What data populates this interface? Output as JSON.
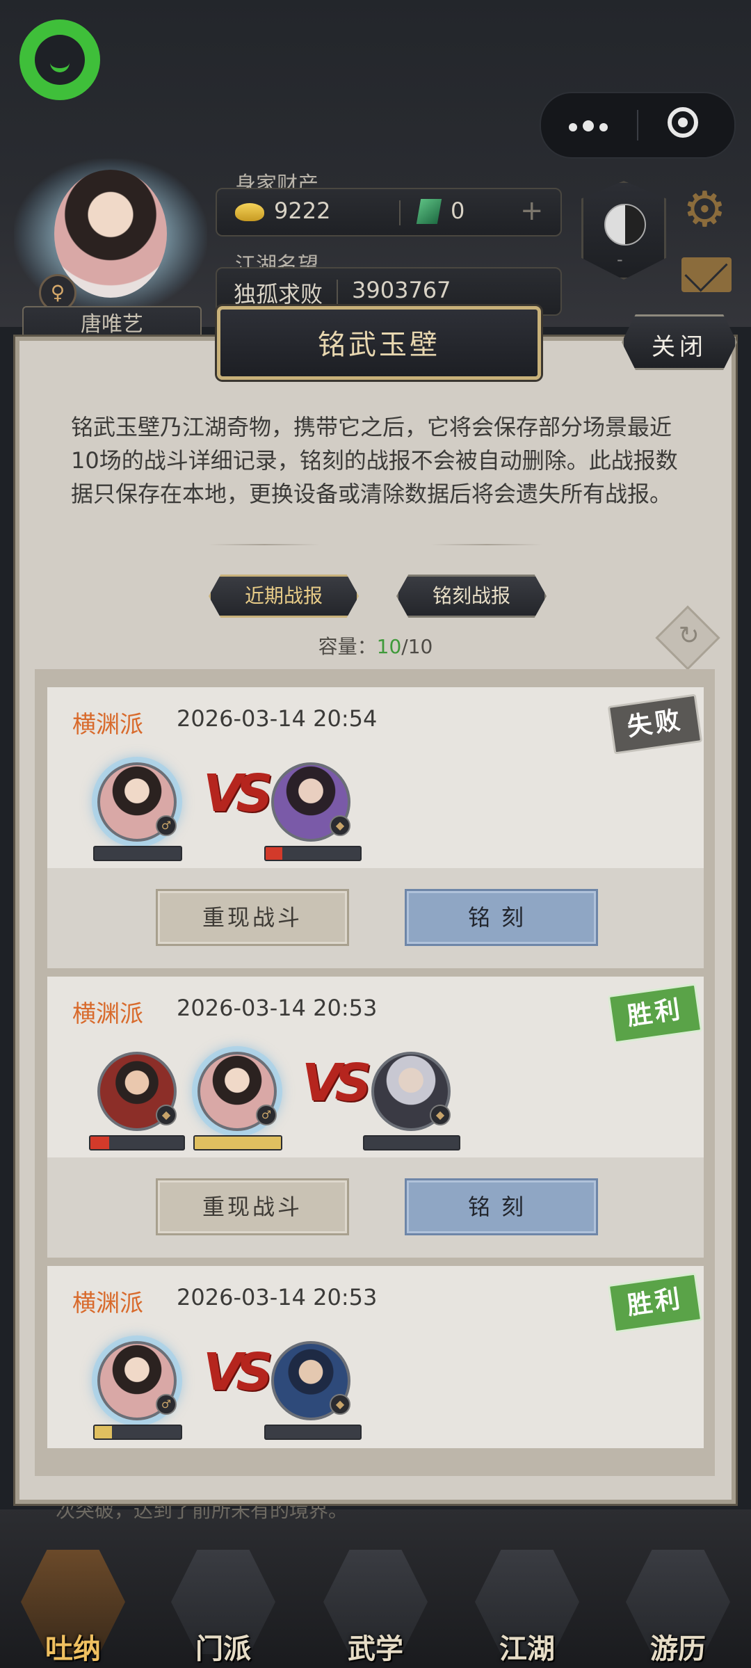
{
  "header": {
    "wealth_label": "身家财产",
    "gold_amount": "9222",
    "jade_amount": "0",
    "fame_label": "江湖名望",
    "fame_title": "独孤求败",
    "fame_value": "3903767",
    "player_name": "唐唯艺",
    "taiji_level": "-"
  },
  "modal": {
    "title": "铭武玉壁",
    "close_label": "关闭",
    "description": "铭武玉壁乃江湖奇物，携带它之后，它将会保存部分场景最近10场的战斗详细记录，铭刻的战报不会被自动删除。此战报数据只保存在本地，更换设备或清除数据后将会遗失所有战报。",
    "tabs": [
      {
        "label": "近期战报",
        "active": true
      },
      {
        "label": "铭刻战报",
        "active": false
      }
    ],
    "capacity_label": "容量：",
    "capacity_used": "10",
    "capacity_total": "/10"
  },
  "battles": [
    {
      "school": "横渊派",
      "time": "2026-03-14 20:54",
      "result": "失败",
      "ally_hp": [
        0
      ],
      "enemy_hp": [
        0.18
      ],
      "replay_label": "重现战斗",
      "engrave_label": "铭刻"
    },
    {
      "school": "横渊派",
      "time": "2026-03-14 20:53",
      "result": "胜利",
      "ally_hp": [
        0.2,
        1.0
      ],
      "enemy_hp": [
        0
      ],
      "replay_label": "重现战斗",
      "engrave_label": "铭刻"
    },
    {
      "school": "横渊派",
      "time": "2026-03-14 20:53",
      "result": "胜利",
      "ally_hp": [
        0.2
      ],
      "enemy_hp": [
        0
      ]
    }
  ],
  "behind_text": "次突破，达到了前所未有的境界。",
  "nav": [
    {
      "label": "吐纳",
      "active": true
    },
    {
      "label": "门派",
      "active": false
    },
    {
      "label": "武学",
      "active": false
    },
    {
      "label": "江湖",
      "active": false
    },
    {
      "label": "游历",
      "active": false
    }
  ],
  "colors": {
    "school": "#d86a2c",
    "win": "#5aa348",
    "loss": "#5a5855",
    "hp_red": "#d33a2a",
    "hp_gold": "#e0c060",
    "capacity_green": "#3f9a3a"
  }
}
